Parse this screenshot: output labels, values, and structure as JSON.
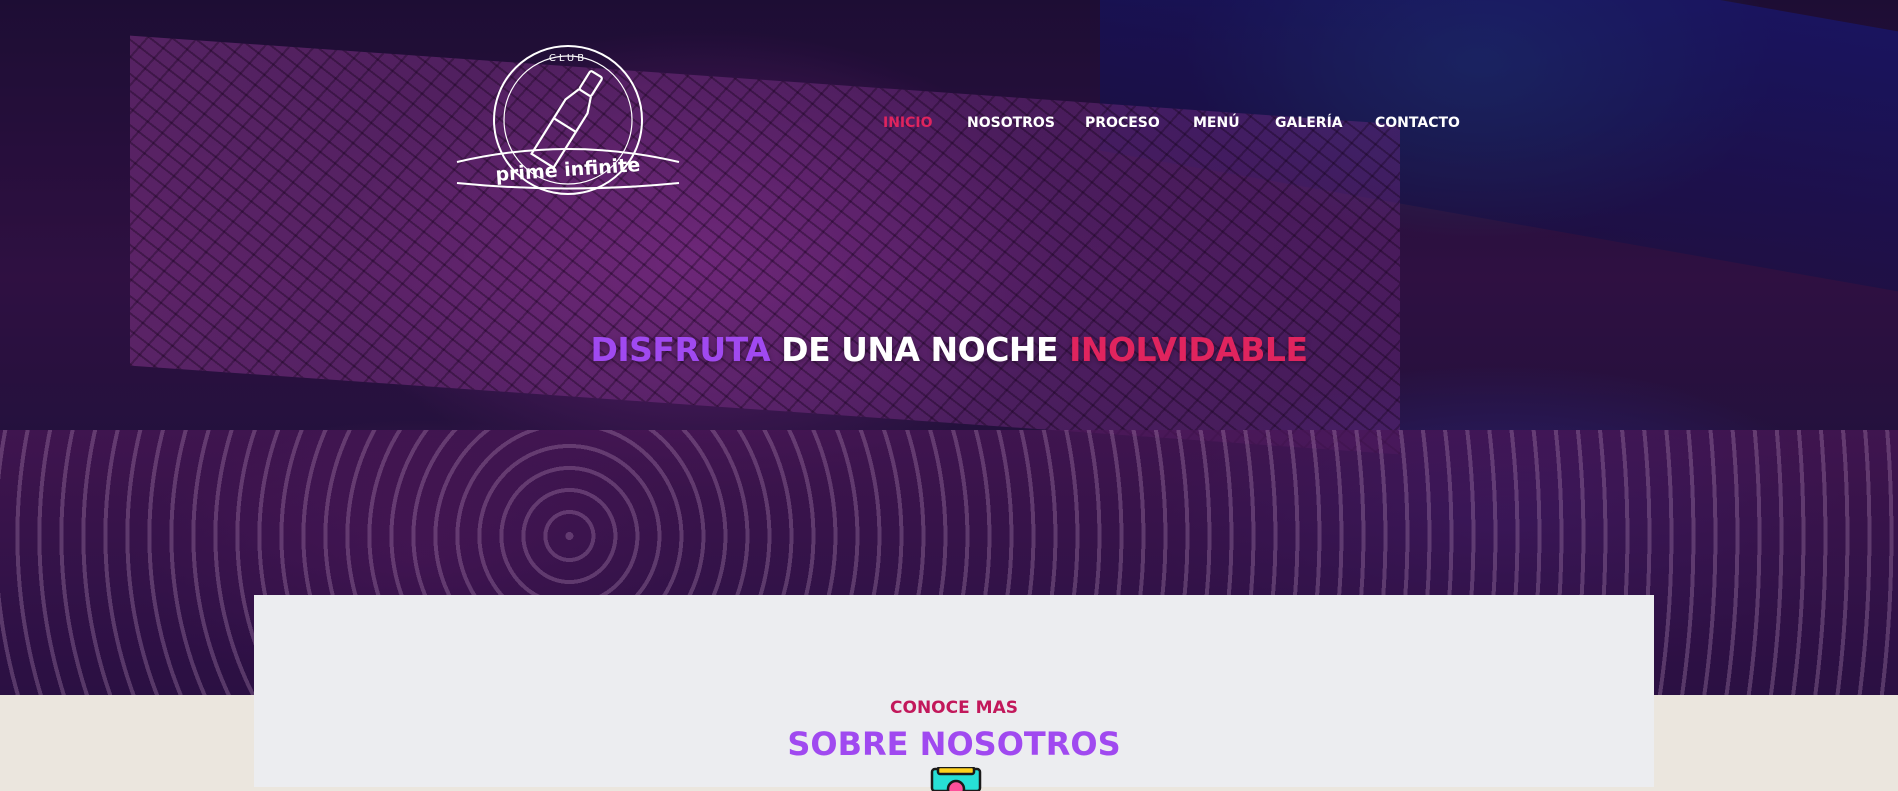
{
  "brand": {
    "top_text": "CLUB",
    "name": "prime infinite"
  },
  "nav": {
    "items": [
      {
        "label": "INICIO",
        "active": true
      },
      {
        "label": "NOSOTROS",
        "active": false
      },
      {
        "label": "PROCESO",
        "active": false
      },
      {
        "label": "MENÚ",
        "active": false
      },
      {
        "label": "GALERÍA",
        "active": false
      },
      {
        "label": "CONTACTO",
        "active": false
      }
    ]
  },
  "hero": {
    "headline_part1": "DISFRUTA",
    "headline_part2": "DE UNA NOCHE",
    "headline_part3": "INOLVIDABLE"
  },
  "about": {
    "kicker": "CONOCE MAS",
    "title": "SOBRE NOSOTROS",
    "icon": "cocktail-machine-icon"
  },
  "colors": {
    "accent_purple": "#a049f0",
    "accent_red": "#e0245e",
    "kicker_red": "#c2185b",
    "page_background": "#ebe6de",
    "card_background": "#ecedf0"
  }
}
